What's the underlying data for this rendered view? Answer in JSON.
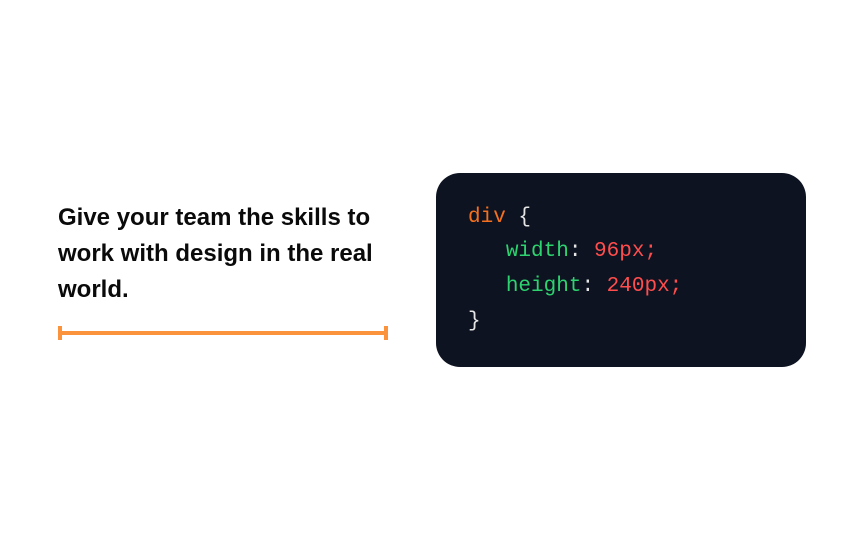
{
  "headline": "Give your team the skills to work with design in the real world.",
  "code": {
    "selector": "div",
    "brace_open": "{",
    "brace_close": "}",
    "indent": "   ",
    "rules": [
      {
        "property": "width",
        "value": "96px"
      },
      {
        "property": "height",
        "value": "240px"
      }
    ],
    "colon_space": ": ",
    "semicolon": ";"
  },
  "accent_color": "#fb923c"
}
